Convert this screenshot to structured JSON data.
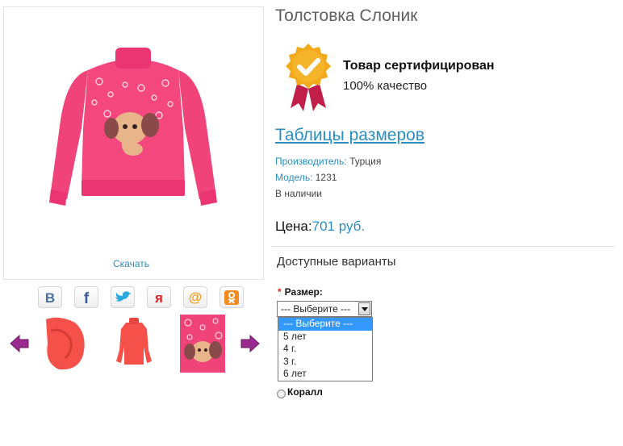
{
  "product": {
    "title": "Толстовка Слоник",
    "download_label": "Скачать",
    "certificate": {
      "title": "Товар сертифицирован",
      "subtitle": "100% качество"
    },
    "size_table_link": "Таблицы размеров",
    "manufacturer": {
      "label": "Производитель:",
      "value": "Турция"
    },
    "model": {
      "label": "Модель:",
      "value": "1231"
    },
    "availability": "В наличии",
    "price": {
      "label": "Цена:",
      "value": "701 руб."
    }
  },
  "share": {
    "icons": [
      "vk-icon",
      "facebook-icon",
      "twitter-icon",
      "yaru-icon",
      "mail-icon",
      "odnoklassniki-icon"
    ],
    "colors": {
      "vk": "#4e6e9b",
      "facebook": "#3b5998",
      "twitter": "#2aa9e0",
      "yaru": "#e02424",
      "mail": "#f29d1e",
      "odnoklassniki": "#f28a1e"
    }
  },
  "variants": {
    "title": "Доступные варианты",
    "size": {
      "required_mark": "*",
      "label": "Размер:",
      "selected": "--- Выберите ---",
      "options": [
        "--- Выберите ---",
        "5 лет",
        "4 г.",
        "3 г.",
        "6 лет"
      ]
    },
    "color_option": "Коралл"
  },
  "colors": {
    "accent": "#2a8ec2",
    "product_pink": "#f0437a",
    "coral": "#f5504a",
    "select_highlight": "#3399ff"
  }
}
